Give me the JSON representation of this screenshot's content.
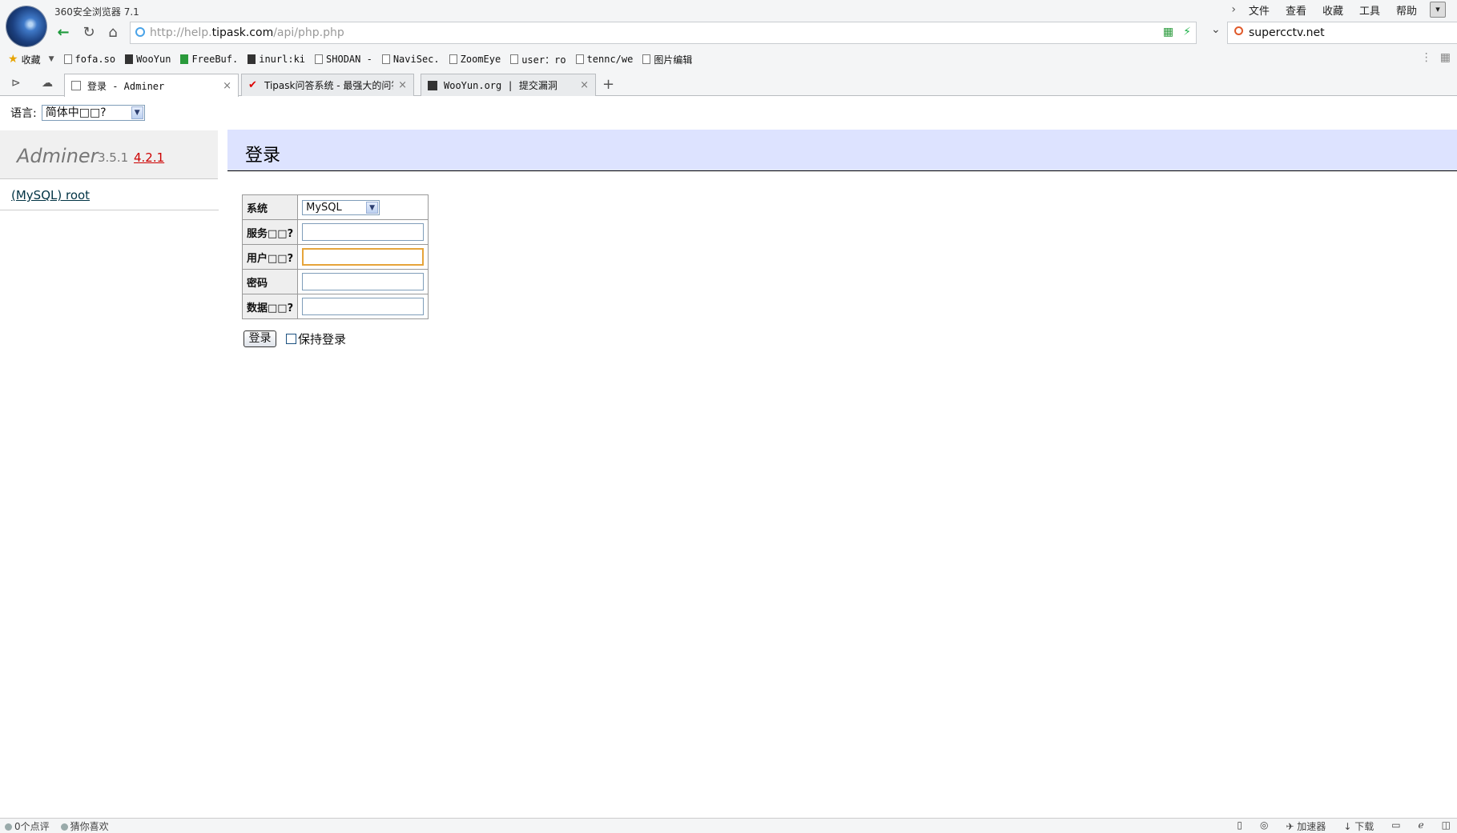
{
  "browser": {
    "title": "360安全浏览器 7.1",
    "menu": [
      "文件",
      "查看",
      "收藏",
      "工具",
      "帮助"
    ],
    "url": {
      "prefix": "http://help.",
      "host": "tipask.com",
      "path": "/api/php.php"
    },
    "search_value": "supercctv.net",
    "favorites_label": "收藏",
    "bookmarks": [
      "fofa.so",
      "WooYun",
      "FreeBuf.",
      "inurl:ki",
      "SHODAN -",
      "NaviSec.",
      "ZoomEye",
      "user：ro",
      "tennc/we",
      "图片编辑"
    ],
    "tabs": [
      {
        "label": "登录 - Adminer",
        "active": true
      },
      {
        "label": "Tipask问答系统 - 最强大的问答",
        "active": false
      },
      {
        "label": "WooYun.org | 提交漏洞",
        "active": false
      }
    ],
    "status_left": [
      "0个点评",
      "猜你喜欢"
    ],
    "status_right": [
      "加速器",
      "下载"
    ]
  },
  "page": {
    "lang_label": "语言:",
    "lang_value": "简体中□□?",
    "app_name": "Adminer",
    "version": "3.5.1",
    "new_version": "4.2.1",
    "server_link": "(MySQL) root",
    "heading": "登录",
    "form": {
      "system_label": "系统",
      "system_value": "MySQL",
      "server_label": "服务□□?",
      "server_value": "",
      "username_label": "用户□□?",
      "username_value": "",
      "password_label": "密码",
      "password_value": "",
      "database_label": "数据□□?",
      "database_value": ""
    },
    "login_button": "登录",
    "keep_login": "保持登录"
  },
  "colors": {
    "header_bg": "#dde3ff",
    "sidebar_bg": "#f0f0f0",
    "new_version": "#cc0000",
    "focus_border": "#e6a43a"
  }
}
